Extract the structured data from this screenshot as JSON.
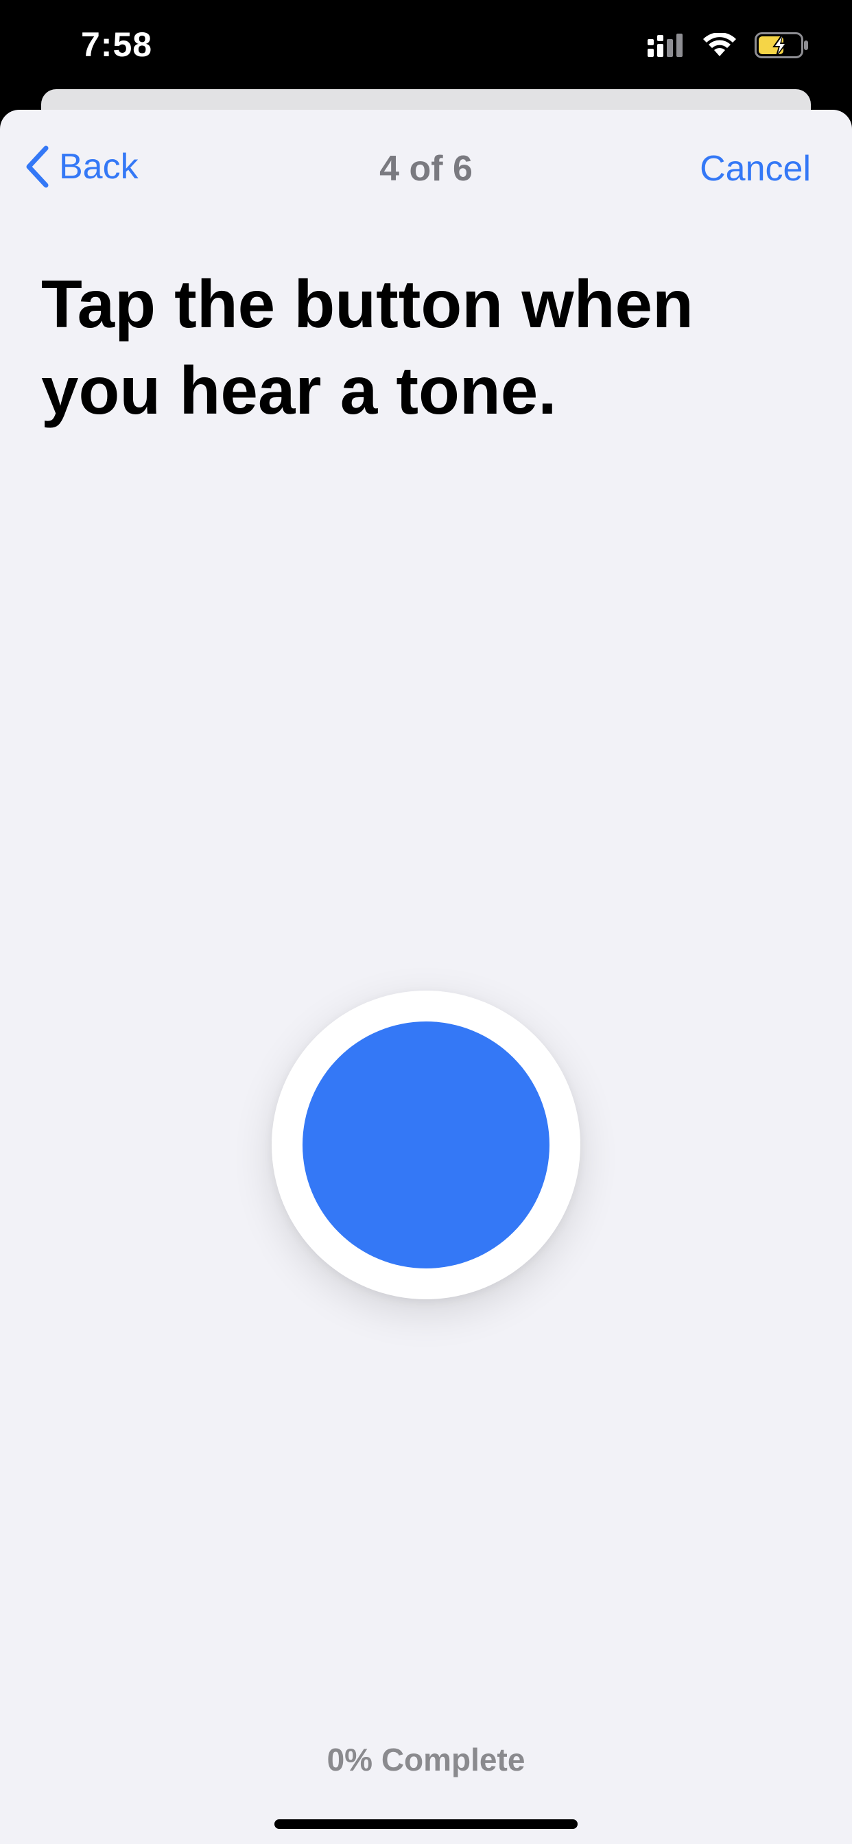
{
  "status_bar": {
    "time": "7:58",
    "icons": [
      "cellular-signal-icon",
      "wifi-icon",
      "battery-charging-icon"
    ],
    "battery_color": "#f5d547"
  },
  "nav": {
    "back_label": "Back",
    "title": "4 of 6",
    "cancel_label": "Cancel"
  },
  "main": {
    "heading_line1": "Tap the button when",
    "heading_line2": "you hear a tone."
  },
  "footer": {
    "progress_text": "0% Complete",
    "progress_fraction": 0
  },
  "colors": {
    "accent": "#3478f6",
    "background": "#f2f2f7",
    "secondary_text": "#8a8a8e"
  }
}
